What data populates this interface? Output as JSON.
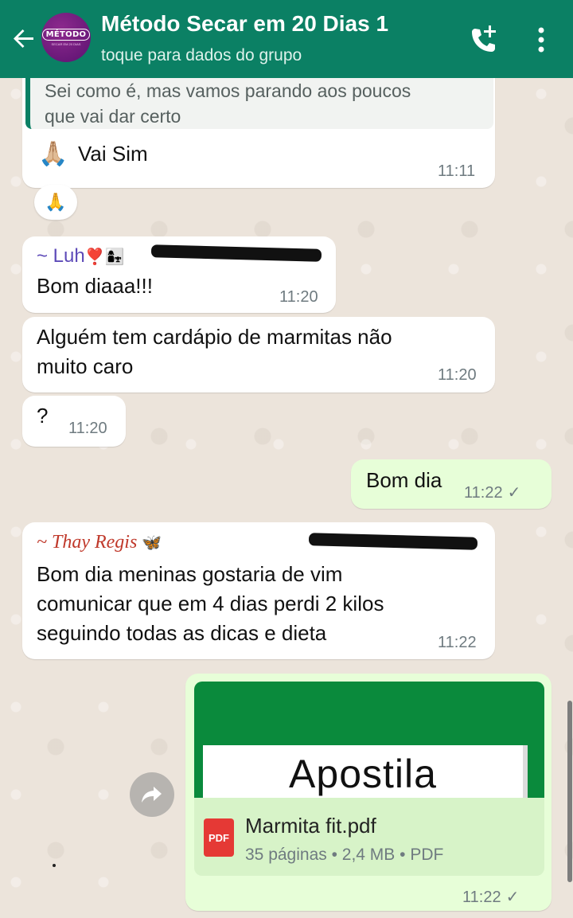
{
  "header": {
    "title": "Método Secar em 20 Dias 1",
    "subtitle": "toque para dados do grupo",
    "avatar_text": "MÉTODO",
    "avatar_subtext": "SECAR EM 20 DIAS",
    "colors": {
      "bar": "#0b8064"
    },
    "icons": [
      "back-arrow-icon",
      "add-call-icon",
      "more-vert-icon"
    ]
  },
  "messages": [
    {
      "quote_lines": [
        "Sei como é, mas vamos parando aos poucos",
        "que vai dar certo"
      ],
      "emoji": "🙏🏼",
      "text": "Vai Sim",
      "time": "11:11",
      "reaction": "🙏"
    },
    {
      "sender": "~ Luh",
      "sender_emoji": "❣️👩‍👧",
      "text": "Bom diaaa!!!",
      "time": "11:20"
    },
    {
      "lines": [
        "Alguém tem cardápio de marmitas não",
        "muito caro"
      ],
      "time": "11:20"
    },
    {
      "text": "?",
      "time": "11:20"
    },
    {
      "text": "Bom dia",
      "time": "11:22",
      "outgoing": true,
      "status": "✓"
    },
    {
      "sender": "~ Thay Regis",
      "sender_emoji": "🦋",
      "lines": [
        "Bom dia meninas gostaria de vim",
        "comunicar que em 4 dias perdi 2 kilos",
        "seguindo todas as dicas e dieta"
      ],
      "time": "11:22"
    },
    {
      "outgoing": true,
      "document": {
        "preview_text": "Apostila",
        "filename": "Marmita fit.pdf",
        "meta": "35 páginas • 2,4 MB • PDF",
        "icon_label": "PDF"
      },
      "time": "11:22",
      "status": "✓"
    }
  ]
}
